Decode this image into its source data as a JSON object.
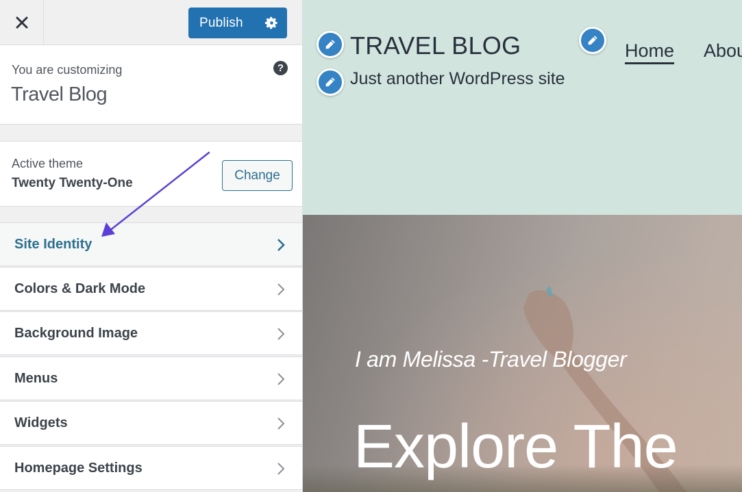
{
  "sidebar": {
    "close_label": "Close",
    "publish_label": "Publish",
    "customizing_label": "You are customizing",
    "site_name": "Travel Blog",
    "help_glyph": "?",
    "active_theme_label": "Active theme",
    "active_theme_name": "Twenty Twenty-One",
    "change_label": "Change",
    "sections": [
      {
        "label": "Site Identity",
        "active": true
      },
      {
        "label": "Colors & Dark Mode",
        "active": false
      },
      {
        "label": "Background Image",
        "active": false
      },
      {
        "label": "Menus",
        "active": false
      },
      {
        "label": "Widgets",
        "active": false
      },
      {
        "label": "Homepage Settings",
        "active": false
      }
    ]
  },
  "preview": {
    "site_title": "TRAVEL BLOG",
    "tagline": "Just another WordPress site",
    "nav": [
      "Home",
      "Abou"
    ],
    "hero_subtitle": "I am Melissa -Travel Blogger",
    "hero_title": "Explore The"
  },
  "colors": {
    "accent": "#2271b1",
    "active_section": "#2c6f8f",
    "annotation_arrow": "#5b3fd6",
    "header_bg": "#d1e4dd",
    "edit_shortcut": "#3582c4"
  }
}
